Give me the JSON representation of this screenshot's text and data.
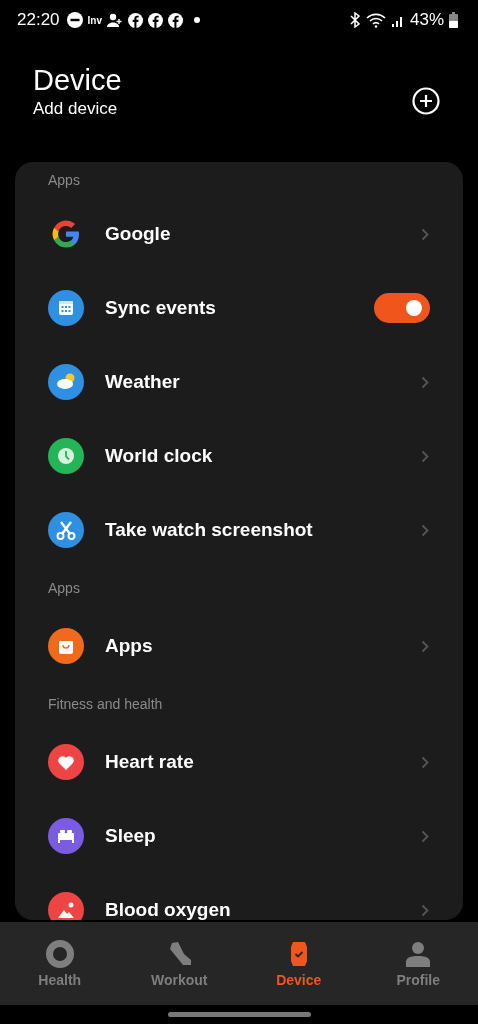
{
  "status_bar": {
    "time": "22:20",
    "notification_text": "Inv",
    "battery": "43%"
  },
  "header": {
    "title": "Device",
    "subtitle": "Add device"
  },
  "sections": [
    {
      "title": "Apps",
      "items": [
        {
          "label": "Google",
          "kind": "google"
        },
        {
          "label": "Sync events",
          "kind": "calendar",
          "color": "#2f8fe0",
          "on": true
        },
        {
          "label": "Weather",
          "kind": "weather",
          "color": "#2f8fe0"
        },
        {
          "label": "World clock",
          "kind": "clock",
          "color": "#25b457"
        },
        {
          "label": "Take watch screenshot",
          "kind": "scissors",
          "color": "#2f8fe0"
        }
      ]
    },
    {
      "title": "Apps",
      "items": [
        {
          "label": "Apps",
          "kind": "bag",
          "color": "#f06a1c"
        }
      ]
    },
    {
      "title": "Fitness and health",
      "items": [
        {
          "label": "Heart rate",
          "kind": "heart",
          "color": "#ee4444"
        },
        {
          "label": "Sleep",
          "kind": "bed",
          "color": "#7a5ce0"
        },
        {
          "label": "Blood oxygen",
          "kind": "drop",
          "color": "#ee4444"
        }
      ]
    }
  ],
  "nav": [
    {
      "label": "Health",
      "kind": "ring",
      "selected": false
    },
    {
      "label": "Workout",
      "kind": "shoe",
      "selected": false
    },
    {
      "label": "Device",
      "kind": "watch",
      "selected": true
    },
    {
      "label": "Profile",
      "kind": "person",
      "selected": false
    }
  ]
}
